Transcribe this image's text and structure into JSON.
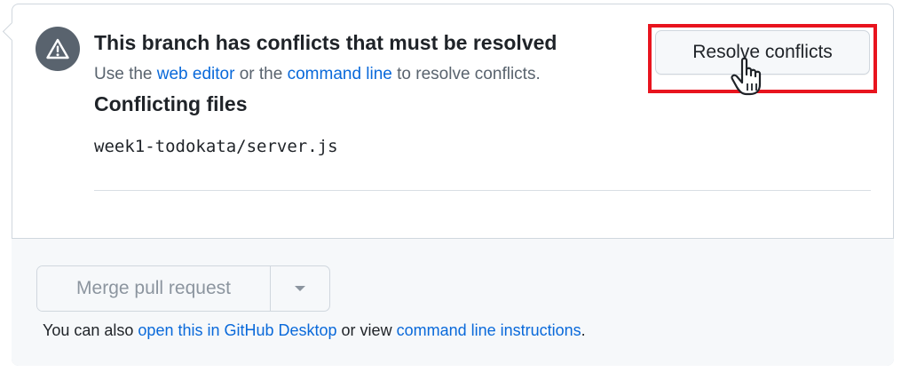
{
  "conflict": {
    "title": "This branch has conflicts that must be resolved",
    "subtitle": {
      "prefix": "Use the ",
      "web_editor_link": "web editor",
      "middle": " or the ",
      "command_line_link": "command line",
      "suffix": " to resolve conflicts."
    },
    "resolve_button_label": "Resolve conflicts",
    "conflicting_files_heading": "Conflicting files",
    "files": [
      "week1-todokata/server.js"
    ],
    "icon": "alert-icon"
  },
  "merge": {
    "button_label": "Merge pull request",
    "dropdown_icon": "triangle-down-icon",
    "footer": {
      "prefix": "You can also ",
      "desktop_link": "open this in GitHub Desktop",
      "middle": " or view ",
      "cli_link": "command line instructions",
      "suffix": "."
    }
  },
  "colors": {
    "link": "#0969da",
    "highlight": "#e8141e",
    "icon_bg": "#59636e",
    "footer_bg": "#f6f8fa"
  }
}
